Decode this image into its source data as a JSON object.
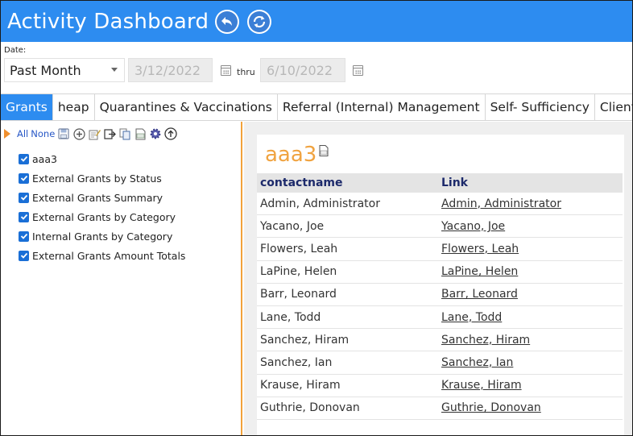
{
  "header": {
    "title": "Activity Dashboard",
    "back_icon": "undo-arrow-icon",
    "refresh_icon": "refresh-icon",
    "accent_color": "#2d8cf0"
  },
  "filters": {
    "date_label": "Date:",
    "period_value": "Past Month",
    "start_date": "3/12/2022",
    "thru_label": "thru",
    "end_date": "6/10/2022"
  },
  "tabs": [
    {
      "label": "Grants",
      "active": true
    },
    {
      "label": "heap",
      "active": false
    },
    {
      "label": "Quarantines & Vaccinations",
      "active": false
    },
    {
      "label": "Referral (Internal) Management",
      "active": false
    },
    {
      "label": "Self- Sufficiency",
      "active": false
    },
    {
      "label": "Client Dem",
      "active": false
    }
  ],
  "toolbar": {
    "all_label": "All",
    "none_label": "None",
    "icons": [
      "save-icon",
      "add-icon",
      "edit-icon",
      "export-icon",
      "copy-icon",
      "excel-icon",
      "settings-icon",
      "upload-icon"
    ]
  },
  "reports": [
    {
      "label": "aaa3",
      "checked": true
    },
    {
      "label": "External Grants by Status",
      "checked": true
    },
    {
      "label": "External Grants Summary",
      "checked": true
    },
    {
      "label": "External Grants by Category",
      "checked": true
    },
    {
      "label": "Internal Grants by Category",
      "checked": true
    },
    {
      "label": "External Grants Amount Totals",
      "checked": true
    }
  ],
  "report_view": {
    "title": "aaa3",
    "columns": [
      "contactname",
      "Link"
    ],
    "rows": [
      {
        "contactname": "Admin, Administrator",
        "link": "Admin, Administrator"
      },
      {
        "contactname": "Yacano, Joe",
        "link": "Yacano, Joe"
      },
      {
        "contactname": "Flowers, Leah",
        "link": "Flowers, Leah"
      },
      {
        "contactname": "LaPine, Helen",
        "link": "LaPine, Helen"
      },
      {
        "contactname": "Barr, Leonard",
        "link": "Barr, Leonard"
      },
      {
        "contactname": "Lane, Todd",
        "link": "Lane, Todd"
      },
      {
        "contactname": "Sanchez, Hiram",
        "link": "Sanchez, Hiram"
      },
      {
        "contactname": "Sanchez, Ian",
        "link": "Sanchez, Ian"
      },
      {
        "contactname": "Krause, Hiram",
        "link": "Krause, Hiram"
      },
      {
        "contactname": "Guthrie, Donovan",
        "link": "Guthrie, Donovan"
      }
    ]
  }
}
